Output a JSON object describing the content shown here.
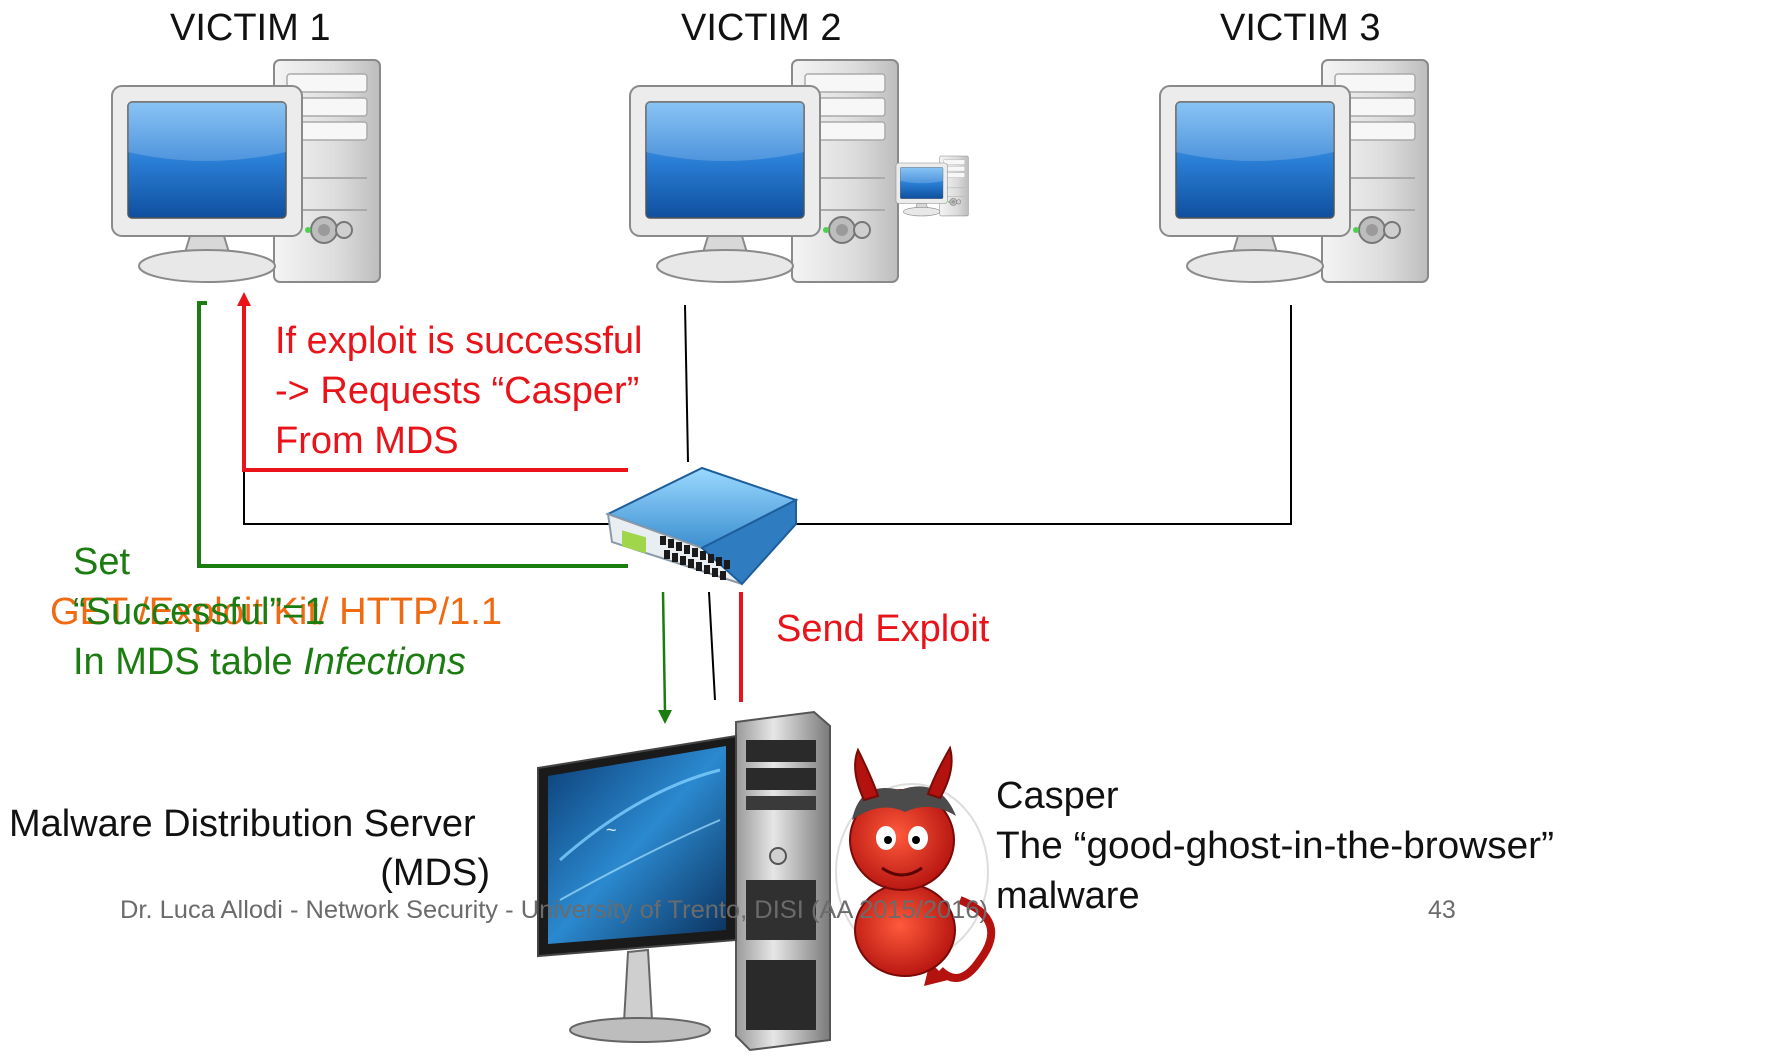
{
  "victims": [
    {
      "label": "VICTIM 1"
    },
    {
      "label": "VICTIM 2"
    },
    {
      "label": "VICTIM 3"
    }
  ],
  "annotations": {
    "if_exploit_line1": "If exploit is successful",
    "if_exploit_line2": "-> Requests “Casper”",
    "if_exploit_line3": "From MDS",
    "set_line1": "Set",
    "set_line2": "“Successful”=1",
    "set_line3_prefix": "In MDS table ",
    "set_line3_italic": "Infections",
    "get_request": "GET /Exploit Kit/ HTTP/1.1",
    "send_exploit": "Send Exploit"
  },
  "server": {
    "label_line1": "Malware Distribution Server",
    "label_line2": "(MDS)"
  },
  "casper": {
    "line1": "Casper",
    "line2": "The “good-ghost-in-the-browser”",
    "line3": "malware"
  },
  "footer": {
    "credit": "Dr. Luca Allodi - Network Security - University of Trento, DISI (AA 2015/2016)",
    "page_number": "43"
  },
  "colors": {
    "red": "#e8141a",
    "green": "#1b7c10",
    "orange": "#f06a12",
    "screen_blue": "#1f73c9",
    "switch_blue": "#5db6e8"
  },
  "icons": [
    "desktop-computer-icon",
    "network-switch-icon",
    "server-tower-icon",
    "devil-mascot-icon"
  ]
}
